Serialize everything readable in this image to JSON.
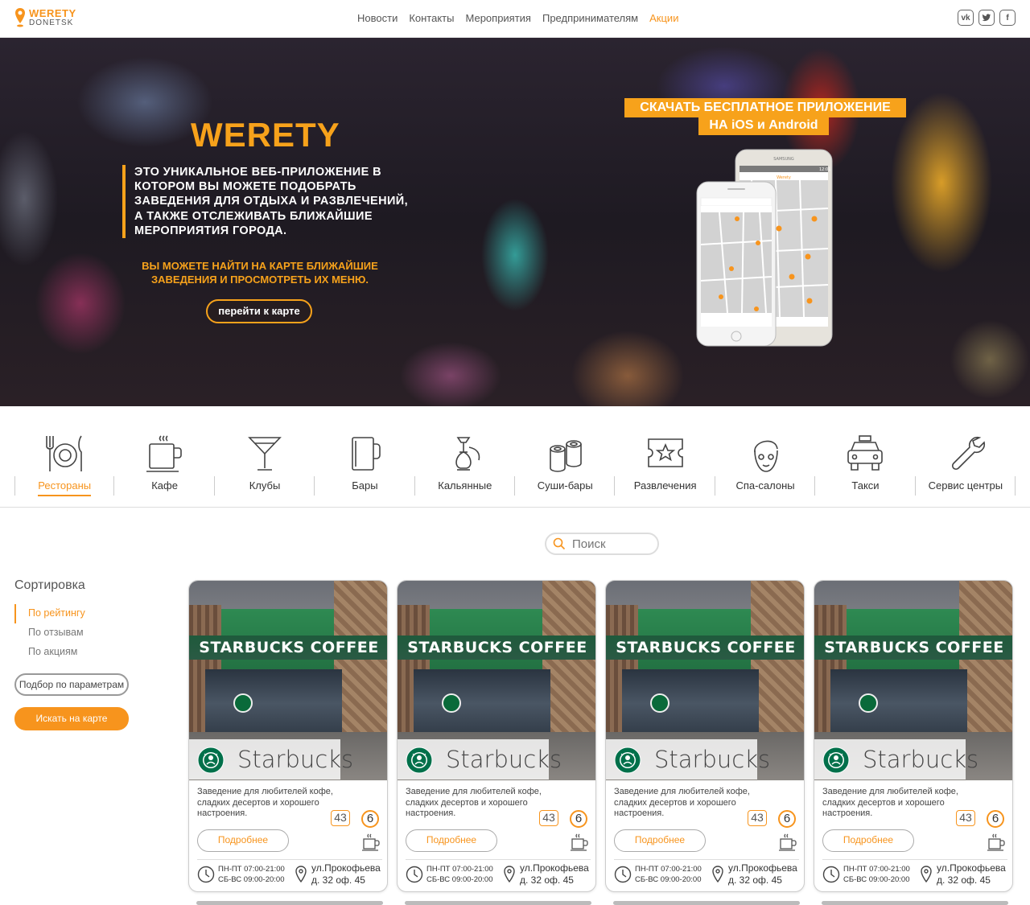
{
  "header": {
    "logo_line1": "WERETY",
    "logo_line2": "DONETSK",
    "nav": [
      "Новости",
      "Контакты",
      "Мероприятия",
      "Предпринимателям",
      "Акции"
    ],
    "social": [
      "vk-icon",
      "twitter-icon",
      "facebook-icon"
    ]
  },
  "hero": {
    "title": "WERETY",
    "description": "Это уникальное веб-приложение в котором вы можете подобрать заведения для отдыха и развлечений, а также отслеживать ближайшие мероприятия города.",
    "subtitle": "Вы можете найти на карте ближайшие заведения и просмотреть их меню.",
    "button": "перейти к карте",
    "download_line1": "СКАЧАТЬ БЕСПЛАТНОЕ ПРИЛОЖЕНИЕ",
    "download_line2": "НА iOS и Android",
    "phone_brand": "SAMSUNG",
    "phone_time": "12:01",
    "phone_app_title": "Werety"
  },
  "categories": [
    {
      "label": "Рестораны",
      "icon": "restaurant-icon",
      "active": true
    },
    {
      "label": "Кафе",
      "icon": "coffee-cup-icon"
    },
    {
      "label": "Клубы",
      "icon": "cocktail-icon"
    },
    {
      "label": "Бары",
      "icon": "beer-mug-icon"
    },
    {
      "label": "Кальянные",
      "icon": "hookah-icon"
    },
    {
      "label": "Суши-бары",
      "icon": "sushi-icon"
    },
    {
      "label": "Развлечения",
      "icon": "ticket-star-icon"
    },
    {
      "label": "Спа-салоны",
      "icon": "spa-face-icon"
    },
    {
      "label": "Такси",
      "icon": "taxi-icon"
    },
    {
      "label": "Сервис центры",
      "icon": "wrench-icon"
    }
  ],
  "search": {
    "placeholder": "Поиск"
  },
  "sidebar": {
    "sort_title": "Сортировка",
    "sort_options": [
      "По рейтингу",
      "По отзывам",
      "По акциям"
    ],
    "active_sort": "По рейтингу",
    "param_button": "Подбор по параметрам",
    "map_button": "Искать на карте"
  },
  "cards": [
    {
      "sign": "STARBUCKS COFFEE",
      "logo_text": "STARBUCKS COFFEE",
      "name": "Starbucks",
      "description": "Заведение для любителей кофе, сладких десертов и хорошего настроения.",
      "reviews": "43",
      "rating": "6",
      "button": "Подробнее",
      "hours1": "ПН-ПТ 07:00-21:00",
      "hours2": "СБ-ВС 09:00-20:00",
      "addr1": "ул.Прокофьева",
      "addr2": "д. 32 оф. 45"
    },
    {
      "sign": "STARBUCKS COFFEE",
      "logo_text": "STARBUCKS COFFEE",
      "name": "Starbucks",
      "description": "Заведение для любителей кофе, сладких десертов и хорошего настроения.",
      "reviews": "43",
      "rating": "6",
      "button": "Подробнее",
      "hours1": "ПН-ПТ 07:00-21:00",
      "hours2": "СБ-ВС 09:00-20:00",
      "addr1": "ул.Прокофьева",
      "addr2": "д. 32 оф. 45"
    },
    {
      "sign": "STARBUCKS COFFEE",
      "logo_text": "STARBUCKS COFFEE",
      "name": "Starbucks",
      "description": "Заведение для любителей кофе, сладких десертов и хорошего настроения.",
      "reviews": "43",
      "rating": "6",
      "button": "Подробнее",
      "hours1": "ПН-ПТ 07:00-21:00",
      "hours2": "СБ-ВС 09:00-20:00",
      "addr1": "ул.Прокофьева",
      "addr2": "д. 32 оф. 45"
    },
    {
      "sign": "STARBUCKS COFFEE",
      "logo_text": "STARBUCKS COFFEE",
      "name": "Starbucks",
      "description": "Заведение для любителей кофе, сладких десертов и хорошего настроения.",
      "reviews": "43",
      "rating": "6",
      "button": "Подробнее",
      "hours1": "ПН-ПТ 07:00-21:00",
      "hours2": "СБ-ВС 09:00-20:00",
      "addr1": "ул.Прокофьева",
      "addr2": "д. 32 оф. 45"
    }
  ],
  "colors": {
    "accent": "#f7941d",
    "hero_accent": "#f7a21b"
  }
}
